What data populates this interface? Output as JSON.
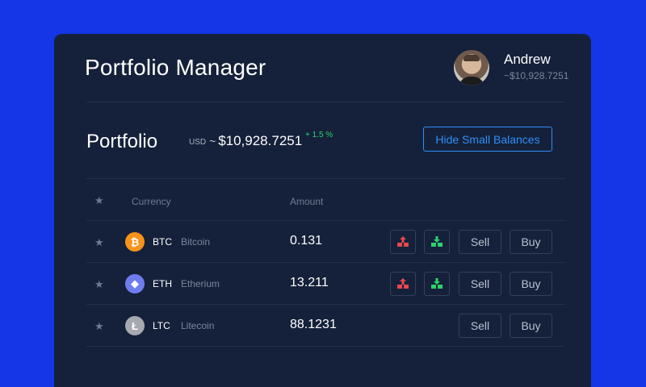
{
  "app": {
    "title": "Portfolio Manager"
  },
  "user": {
    "name": "Andrew",
    "balance": "~$10,928.7251"
  },
  "portfolio": {
    "title": "Portfolio",
    "currency": "USD",
    "tilde": "~",
    "total": "$10,928.7251",
    "change": "+ 1.5 %",
    "hide_small_label": "Hide Small Balances"
  },
  "table": {
    "headers": {
      "star": "★",
      "currency": "Currency",
      "amount": "Amount"
    },
    "rows": [
      {
        "star": "★",
        "symbol": "BTC",
        "name": "Bitcoin",
        "amount": "0.131",
        "icon": "bitcoin-icon",
        "icon_glyph": "₿",
        "color": "#f7931a",
        "has_transfer": true,
        "sell": "Sell",
        "buy": "Buy"
      },
      {
        "star": "★",
        "symbol": "ETH",
        "name": "Etherium",
        "amount": "13.211",
        "icon": "ethereum-icon",
        "icon_glyph": "◆",
        "color": "#6f7cf0",
        "has_transfer": true,
        "sell": "Sell",
        "buy": "Buy"
      },
      {
        "star": "★",
        "symbol": "LTC",
        "name": "Litecoin",
        "amount": "88.1231",
        "icon": "litecoin-icon",
        "icon_glyph": "Ł",
        "color": "#a6a9b0",
        "has_transfer": false,
        "sell": "Sell",
        "buy": "Buy"
      }
    ]
  },
  "colors": {
    "background": "#1436e6",
    "card": "#15213a",
    "accent": "#2e8ef7",
    "positive": "#2bd36a",
    "withdraw": "#e5484d",
    "deposit": "#2bd36a"
  }
}
